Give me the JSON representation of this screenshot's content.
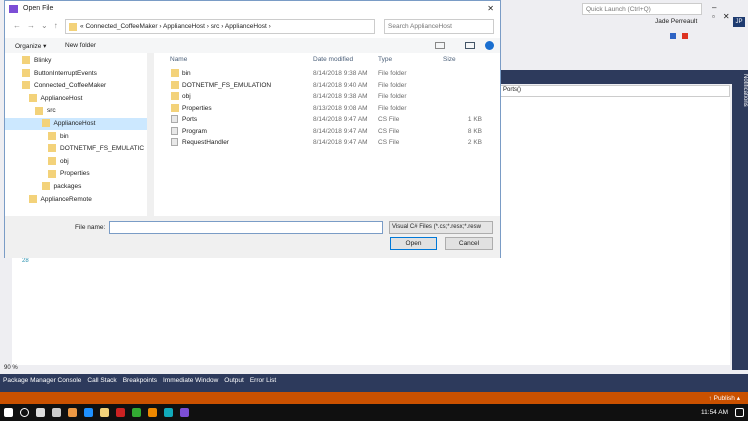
{
  "vs": {
    "quick_launch": "Quick Launch (Ctrl+Q)",
    "user": "Jade Perreault",
    "avatar": "JP",
    "nav_member": "Ports()",
    "notifications": "Notifications",
    "line_number": "28",
    "zoom": "90 %",
    "bottom_tabs": [
      "Package Manager Console",
      "Call Stack",
      "Breakpoints",
      "Immediate Window",
      "Output",
      "Error List"
    ],
    "publish": "↑ Publish ▴",
    "accent": "#ca5100"
  },
  "dialog": {
    "title": "Open File",
    "close": "✕",
    "breadcrumb": [
      "«",
      "Connected_CoffeeMaker",
      "›",
      "ApplianceHost",
      "›",
      "src",
      "›",
      "ApplianceHost",
      "›"
    ],
    "search_placeholder": "Search ApplianceHost",
    "organize": "Organize ▾",
    "new_folder": "New folder",
    "tree": [
      {
        "label": "Blinky",
        "level": 2
      },
      {
        "label": "ButtonInterruptEvents",
        "level": 2
      },
      {
        "label": "Connected_CoffeeMaker",
        "level": 2
      },
      {
        "label": "ApplianceHost",
        "level": 3
      },
      {
        "label": "src",
        "level": 4
      },
      {
        "label": "ApplianceHost",
        "level": 5,
        "selected": true
      },
      {
        "label": "bin",
        "level": 6
      },
      {
        "label": "DOTNETMF_FS_EMULATIC",
        "level": 6
      },
      {
        "label": "obj",
        "level": 6
      },
      {
        "label": "Properties",
        "level": 6
      },
      {
        "label": "packages",
        "level": 5
      },
      {
        "label": "ApplianceRemote",
        "level": 3
      }
    ],
    "columns": [
      "Name",
      "Date modified",
      "Type",
      "Size"
    ],
    "files": [
      {
        "name": "bin",
        "date": "8/14/2018 9:38 AM",
        "type": "File folder",
        "size": "",
        "folder": true
      },
      {
        "name": "DOTNETMF_FS_EMULATION",
        "date": "8/14/2018 9:40 AM",
        "type": "File folder",
        "size": "",
        "folder": true
      },
      {
        "name": "obj",
        "date": "8/14/2018 9:38 AM",
        "type": "File folder",
        "size": "",
        "folder": true
      },
      {
        "name": "Properties",
        "date": "8/13/2018 9:08 AM",
        "type": "File folder",
        "size": "",
        "folder": true
      },
      {
        "name": "Ports",
        "date": "8/14/2018 9:47 AM",
        "type": "CS File",
        "size": "1 KB"
      },
      {
        "name": "Program",
        "date": "8/14/2018 9:47 AM",
        "type": "CS File",
        "size": "8 KB"
      },
      {
        "name": "RequestHandler",
        "date": "8/14/2018 9:47 AM",
        "type": "CS File",
        "size": "2 KB"
      }
    ],
    "file_name_label": "File name:",
    "file_name_value": "",
    "filter": "Visual C# Files (*.cs;*.resx;*.resw",
    "open": "Open",
    "cancel": "Cancel"
  },
  "taskbar": {
    "time": "11:54 AM"
  }
}
